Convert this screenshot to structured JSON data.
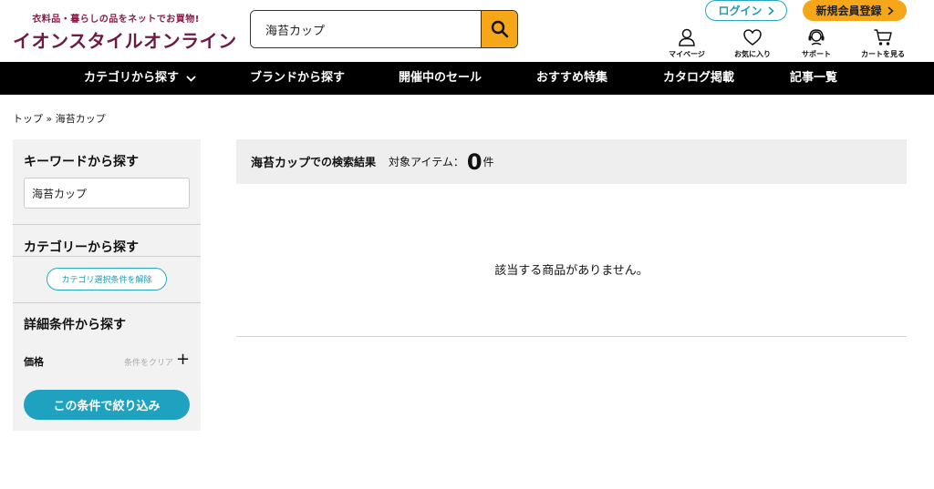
{
  "header": {
    "logo_tagline": "衣料品・暮らしの品をネットでお買物!",
    "logo_name": "イオンスタイルオンライン",
    "search_value": "海苔カップ",
    "login_label": "ログイン",
    "register_label": "新規会員登録",
    "utilities": [
      {
        "label": "マイページ",
        "icon": "person-icon"
      },
      {
        "label": "お気に入り",
        "icon": "heart-icon"
      },
      {
        "label": "サポート",
        "icon": "headset-icon"
      },
      {
        "label": "カートを見る",
        "icon": "cart-icon"
      }
    ],
    "colors": {
      "brand": "#6d1a44",
      "accent": "#f6a719",
      "teal": "#1fa2c0"
    }
  },
  "nav": {
    "items": [
      {
        "label": "カテゴリから探す"
      },
      {
        "label": "ブランドから探す"
      },
      {
        "label": "開催中のセール"
      },
      {
        "label": "おすすめ特集"
      },
      {
        "label": "カタログ掲載"
      },
      {
        "label": "記事一覧"
      }
    ]
  },
  "breadcrumb": {
    "home": "トップ",
    "separator": "»",
    "current": "海苔カップ"
  },
  "sidebar": {
    "keyword_heading": "キーワードから探す",
    "keyword_value": "海苔カップ",
    "category_heading": "カテゴリーから探す",
    "clear_category_label": "カテゴリ選択条件を解除",
    "detail_heading": "詳細条件から探す",
    "price_label": "価格",
    "price_clear_label": "条件をクリア",
    "submit_label": "この条件で絞り込み"
  },
  "results": {
    "keyword": "海苔カップ",
    "keyword_suffix": "での検索結果",
    "target_label": "対象アイテム：",
    "count": "0",
    "unit": "件",
    "empty_message": "該当する商品がありません。"
  }
}
